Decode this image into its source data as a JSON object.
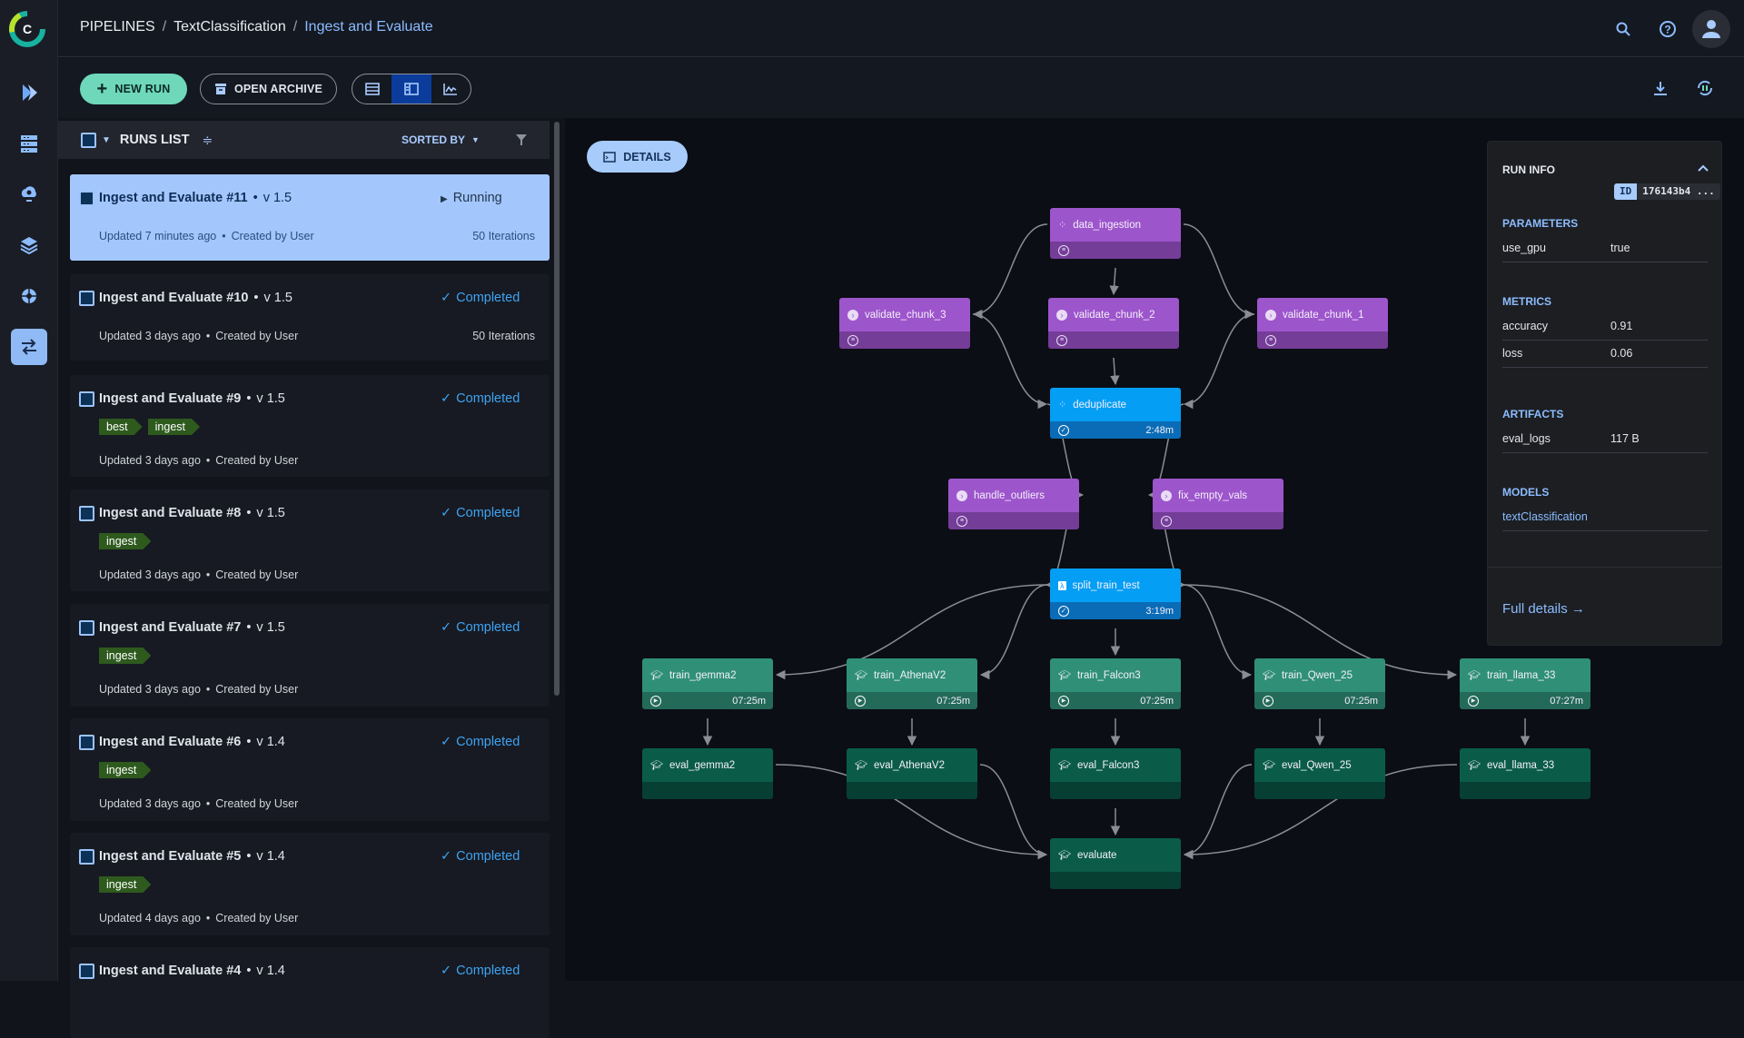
{
  "header": {
    "breadcrumb": [
      "PIPELINES",
      "TextClassification",
      "Ingest and Evaluate"
    ]
  },
  "sidebar": {
    "items": [
      {
        "icon": "pipelines-icon"
      },
      {
        "icon": "datasets-icon"
      },
      {
        "icon": "orchestration-icon"
      },
      {
        "icon": "layers-icon"
      },
      {
        "icon": "model-icon"
      },
      {
        "icon": "pipeline-runs-icon",
        "active": true
      }
    ]
  },
  "toolbar": {
    "new_run": "NEW RUN",
    "open_archive": "OPEN ARCHIVE",
    "views": [
      "table-view",
      "details-view",
      "chart-view"
    ],
    "active_view": "details-view"
  },
  "runs_list": {
    "title": "RUNS LIST",
    "sorted_by": "SORTED BY",
    "runs": [
      {
        "name": "Ingest and Evaluate #11",
        "version": "v 1.5",
        "status": "Running",
        "updated": "Updated 7 minutes ago",
        "created": "Created by User",
        "iterations": "50 Iterations",
        "tags": [],
        "selected": true
      },
      {
        "name": "Ingest and Evaluate #10",
        "version": "v 1.5",
        "status": "Completed",
        "updated": "Updated 3 days ago",
        "created": "Created by User",
        "iterations": "50 Iterations",
        "tags": []
      },
      {
        "name": "Ingest and Evaluate #9",
        "version": "v 1.5",
        "status": "Completed",
        "updated": "Updated 3 days ago",
        "created": "Created by User",
        "tags": [
          "best",
          "ingest"
        ]
      },
      {
        "name": "Ingest and Evaluate #8",
        "version": "v 1.5",
        "status": "Completed",
        "updated": "Updated 3 days ago",
        "created": "Created by User",
        "tags": [
          "ingest"
        ]
      },
      {
        "name": "Ingest and Evaluate #7",
        "version": "v 1.5",
        "status": "Completed",
        "updated": "Updated 3 days ago",
        "created": "Created by User",
        "tags": [
          "ingest"
        ]
      },
      {
        "name": "Ingest and Evaluate #6",
        "version": "v 1.4",
        "status": "Completed",
        "updated": "Updated 3 days ago",
        "created": "Created by User",
        "tags": [
          "ingest"
        ]
      },
      {
        "name": "Ingest and Evaluate #5",
        "version": "v 1.4",
        "status": "Completed",
        "updated": "Updated 4 days ago",
        "created": "Created by User",
        "tags": [
          "ingest"
        ]
      },
      {
        "name": "Ingest and Evaluate #4",
        "version": "v 1.4",
        "status": "Completed",
        "tags": []
      }
    ]
  },
  "canvas": {
    "details_label": "DETAILS",
    "nodes": [
      {
        "id": "data_ingestion",
        "label": "data_ingestion",
        "kind": "purple",
        "status": "queued"
      },
      {
        "id": "validate_chunk_3",
        "label": "validate_chunk_3",
        "kind": "purple",
        "status": "queued"
      },
      {
        "id": "validate_chunk_2",
        "label": "validate_chunk_2",
        "kind": "purple",
        "status": "queued"
      },
      {
        "id": "validate_chunk_1",
        "label": "validate_chunk_1",
        "kind": "purple",
        "status": "queued"
      },
      {
        "id": "deduplicate",
        "label": "deduplicate",
        "kind": "blue",
        "status": "completed",
        "duration": "2:48m"
      },
      {
        "id": "handle_outliers",
        "label": "handle_outliers",
        "kind": "purple",
        "status": "queued"
      },
      {
        "id": "fix_empty_vals",
        "label": "fix_empty_vals",
        "kind": "purple",
        "status": "queued"
      },
      {
        "id": "split_train_test",
        "label": "split_train_test",
        "kind": "blue",
        "status": "completed",
        "duration": "3:19m"
      },
      {
        "id": "train_gemma2",
        "label": "train_gemma2",
        "kind": "train",
        "status": "running",
        "duration": "07:25m"
      },
      {
        "id": "train_AthenaV2",
        "label": "train_AthenaV2",
        "kind": "train",
        "status": "running",
        "duration": "07:25m"
      },
      {
        "id": "train_Falcon3",
        "label": "train_Falcon3",
        "kind": "train",
        "status": "running",
        "duration": "07:25m"
      },
      {
        "id": "train_Qwen_25",
        "label": "train_Qwen_25",
        "kind": "train",
        "status": "running",
        "duration": "07:25m"
      },
      {
        "id": "train_llama_33",
        "label": "train_llama_33",
        "kind": "train",
        "status": "running",
        "duration": "07:27m"
      },
      {
        "id": "eval_gemma2",
        "label": "eval_gemma2",
        "kind": "eval",
        "status": "pending"
      },
      {
        "id": "eval_AthenaV2",
        "label": "eval_AthenaV2",
        "kind": "eval",
        "status": "pending"
      },
      {
        "id": "eval_Falcon3",
        "label": "eval_Falcon3",
        "kind": "eval",
        "status": "pending"
      },
      {
        "id": "eval_Qwen_25",
        "label": "eval_Qwen_25",
        "kind": "eval",
        "status": "pending"
      },
      {
        "id": "eval_llama_33",
        "label": "eval_llama_33",
        "kind": "eval",
        "status": "pending"
      },
      {
        "id": "evaluate",
        "label": "evaluate",
        "kind": "eval",
        "status": "pending"
      }
    ],
    "edges": [
      [
        "data_ingestion",
        "validate_chunk_3"
      ],
      [
        "data_ingestion",
        "validate_chunk_2"
      ],
      [
        "data_ingestion",
        "validate_chunk_1"
      ],
      [
        "validate_chunk_3",
        "deduplicate"
      ],
      [
        "validate_chunk_2",
        "deduplicate"
      ],
      [
        "validate_chunk_1",
        "deduplicate"
      ],
      [
        "deduplicate",
        "handle_outliers"
      ],
      [
        "deduplicate",
        "fix_empty_vals"
      ],
      [
        "handle_outliers",
        "split_train_test"
      ],
      [
        "fix_empty_vals",
        "split_train_test"
      ],
      [
        "split_train_test",
        "train_gemma2"
      ],
      [
        "split_train_test",
        "train_AthenaV2"
      ],
      [
        "split_train_test",
        "train_Falcon3"
      ],
      [
        "split_train_test",
        "train_Qwen_25"
      ],
      [
        "split_train_test",
        "train_llama_33"
      ],
      [
        "train_gemma2",
        "eval_gemma2"
      ],
      [
        "train_AthenaV2",
        "eval_AthenaV2"
      ],
      [
        "train_Falcon3",
        "eval_Falcon3"
      ],
      [
        "train_Qwen_25",
        "eval_Qwen_25"
      ],
      [
        "train_llama_33",
        "eval_llama_33"
      ],
      [
        "eval_gemma2",
        "evaluate"
      ],
      [
        "eval_AthenaV2",
        "evaluate"
      ],
      [
        "eval_Falcon3",
        "evaluate"
      ],
      [
        "eval_Qwen_25",
        "evaluate"
      ],
      [
        "eval_llama_33",
        "evaluate"
      ]
    ]
  },
  "run_info": {
    "title": "RUN INFO",
    "id_label": "ID",
    "id_value": "176143b4 ...",
    "parameters_title": "PARAMETERS",
    "parameters": [
      {
        "k": "use_gpu",
        "v": "true"
      }
    ],
    "metrics_title": "METRICS",
    "metrics": [
      {
        "k": "accuracy",
        "v": "0.91"
      },
      {
        "k": "loss",
        "v": "0.06"
      }
    ],
    "artifacts_title": "ARTIFACTS",
    "artifacts": [
      {
        "k": "eval_logs",
        "v": "117 B"
      }
    ],
    "models_title": "MODELS",
    "models": [
      "textClassification"
    ],
    "full_details": "Full details →"
  },
  "colors": {
    "accent": "#8cbcff",
    "new_run": "#6fd8ba",
    "completed": "#3ea3f2",
    "selected_card": "#a3c7fc",
    "node_purple": "#9d55cc",
    "node_blue": "#049ef5",
    "node_train": "#2f9077",
    "node_eval": "#0a5c49",
    "tag": "#2e5a1e"
  }
}
